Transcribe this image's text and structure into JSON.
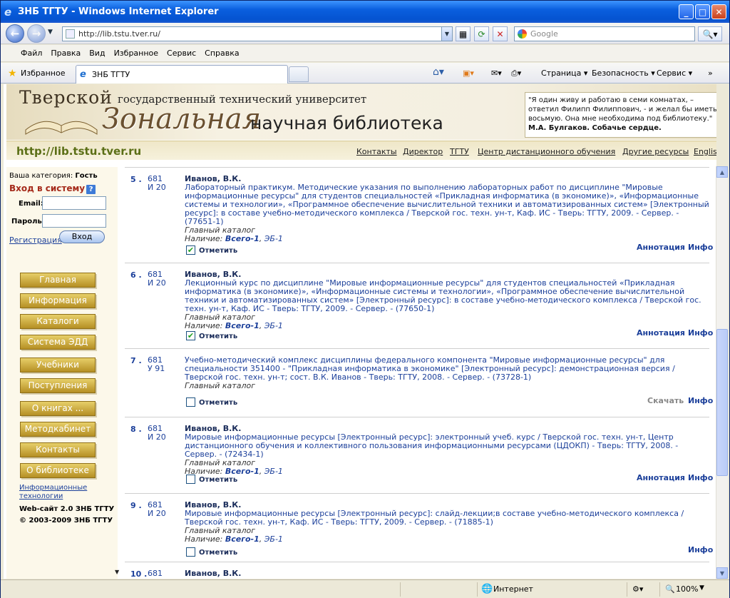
{
  "window": {
    "title": "ЗНБ ТГТУ - Windows Internet Explorer",
    "url": "http://lib.tstu.tver.ru/",
    "search_placeholder": "Google",
    "menu": [
      "Файл",
      "Правка",
      "Вид",
      "Избранное",
      "Сервис",
      "Справка"
    ],
    "favorites_label": "Избранное",
    "tab_title": "ЗНБ ТГТУ",
    "cmd_page": "Страница ▾",
    "cmd_security": "Безопасность ▾",
    "cmd_service": "Сервис ▾",
    "status_zone": "Интернет",
    "zoom": "100%"
  },
  "banner": {
    "line1a": "Тверской",
    "line1b": "государственный технический университет",
    "line2a": "Зональная",
    "line2b": "научная библиотека",
    "quote_text": "\"Я один живу и работаю в семи комнатах, – ответил Филипп Филиппович, - и желал бы иметь восьмую. Она мне необходима под библиотеку.\"",
    "quote_author": "М.А. Булгаков. Собачье сердце."
  },
  "toplinks": {
    "site": "http://lib.tstu.tver.ru",
    "items": [
      "Контакты",
      "Директор",
      "ТГТУ",
      "Центр дистанционного обучения",
      "Другие ресурсы",
      "English"
    ]
  },
  "sidebar": {
    "category": "Ваша категория:",
    "category_value": "Гость",
    "login": "Вход в систему",
    "help": "?",
    "email_label": "Email:",
    "password_label": "Пароль:",
    "register": "Регистрация",
    "enter": "Вход",
    "menu": [
      "Главная",
      "Информация",
      "Каталоги",
      "Система ЭДД",
      "Учебники",
      "Поступления",
      "О книгах ...",
      "Методкабинет",
      "Контакты",
      "О библиотеке"
    ],
    "it1": "Информационные",
    "it2": "технологии",
    "web": "Web-сайт 2.0 ЗНБ ТГТУ",
    "copy": "© 2003-2009 ЗНБ ТГТУ"
  },
  "records": [
    {
      "num": "5 .",
      "code1": "681",
      "code2": "И 20",
      "author": "Иванов, В.К.",
      "text": "Лабораторный практикум. Методические указания по выполнению лабораторных работ по дисциплине \"Мировые информационные ресурсы\" для студентов специальностей «Прикладная информатика (в экономике)», «Информационные системы и технологии», «Программное обеспечение вычислительной техники и автоматизированных систем» [Электронный ресурс]: в составе учебно-методического комплекса / Тверской гос. техн. ун-т, Каф. ИС - Тверь: ТГТУ, 2009. - Сервер. - (77651-1)",
      "catalog": "Главный каталог",
      "avail": "Наличие:",
      "total": "Всего-1",
      "eb": "ЭБ-1",
      "mark": "Отметить",
      "checked": "✔",
      "a1": "Аннотация",
      "a2": "Инфо"
    },
    {
      "num": "6 .",
      "code1": "681",
      "code2": "И 20",
      "author": "Иванов, В.К.",
      "text": "Лекционный курс по дисциплине \"Мировые информационные ресурсы\" для студентов специальностей «Прикладная информатика (в экономике)», «Информационные системы и технологии», «Программное обеспечение вычислительной техники и автоматизированных систем» [Электронный ресурс]: в составе учебно-методического комплекса / Тверской гос. техн. ун-т, Каф. ИС - Тверь: ТГТУ, 2009. - Сервер. - (77650-1)",
      "catalog": "Главный каталог",
      "avail": "Наличие:",
      "total": "Всего-1",
      "eb": "ЭБ-1",
      "mark": "Отметить",
      "checked": "✔",
      "a1": "Аннотация",
      "a2": "Инфо"
    },
    {
      "num": "7 .",
      "code1": "681",
      "code2": "У 91",
      "author": "",
      "text": "Учебно-методический комплекс дисциплины федерального компонента \"Мировые информационные ресурсы\" для специальности 351400 - \"Прикладная информатика в экономике\" [Электронный ресурс]: демонстрационная версия / Тверской гос. техн. ун-т; сост. В.К. Иванов - Тверь: ТГТУ, 2008. - Сервер. - (73728-1)",
      "catalog": "Главный каталог",
      "avail": "",
      "total": "",
      "eb": "",
      "mark": "Отметить",
      "checked": "",
      "a1": "Скачать",
      "a2": "Инфо"
    },
    {
      "num": "8 .",
      "code1": "681",
      "code2": "И 20",
      "author": "Иванов, В.К.",
      "text": "Мировые информационные ресурсы [Электронный ресурс]: электронный учеб. курс / Тверской гос. техн. ун-т, Центр дистанционного обучения и коллективного пользования информационными ресурсами (ЦДОКП) - Тверь: ТГТУ, 2008. - Сервер. - (72434-1)",
      "catalog": "Главный каталог",
      "avail": "Наличие:",
      "total": "Всего-1",
      "eb": "ЭБ-1",
      "mark": "Отметить",
      "checked": "",
      "a1": "Аннотация",
      "a2": "Инфо"
    },
    {
      "num": "9 .",
      "code1": "681",
      "code2": "И 20",
      "author": "Иванов, В.К.",
      "text": "Мировые информационные ресурсы [Электронный ресурс]: слайд-лекции;в составе учебно-методического комплекса / Тверской гос. техн. ун-т, Каф. ИС - Тверь: ТГТУ, 2009. - Сервер. - (71885-1)",
      "catalog": "Главный каталог",
      "avail": "Наличие:",
      "total": "Всего-1",
      "eb": "ЭБ-1",
      "mark": "Отметить",
      "checked": "",
      "a1": "",
      "a2": "Инфо"
    },
    {
      "num": "10 .",
      "code1": "681",
      "code2": "",
      "author": "Иванов, В.К.",
      "text": "",
      "catalog": "",
      "avail": "",
      "total": "",
      "eb": "",
      "mark": "",
      "checked": "",
      "a1": "",
      "a2": ""
    }
  ]
}
